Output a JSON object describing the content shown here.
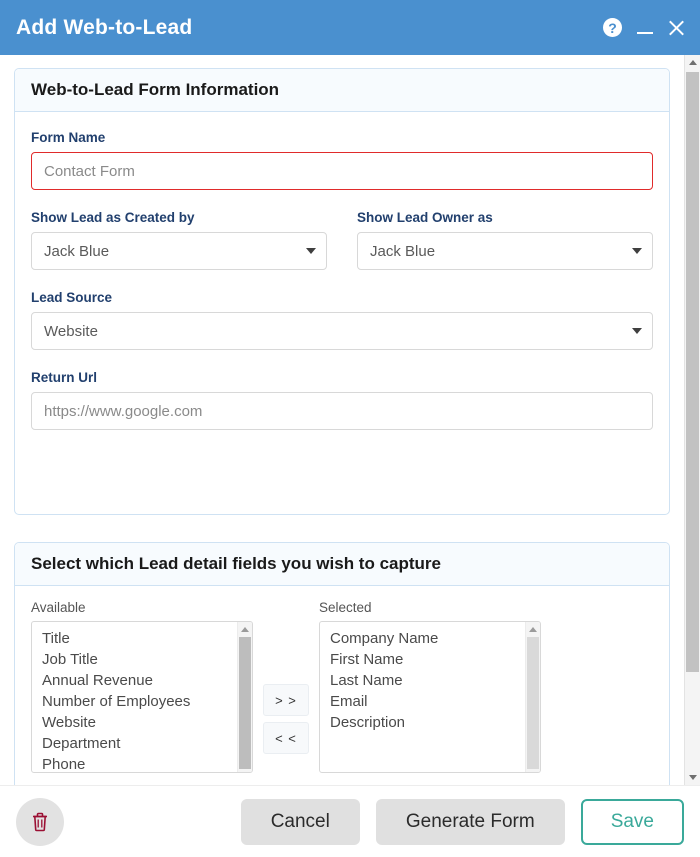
{
  "window": {
    "title": "Add Web-to-Lead",
    "header_color": "#4a90cf",
    "help_glyph": "?",
    "minimize_label": "Minimize",
    "close_label": "Close"
  },
  "info_section": {
    "heading": "Web-to-Lead Form Information",
    "form_name": {
      "label": "Form Name",
      "value": "",
      "placeholder": "Contact Form",
      "invalid": true,
      "error_color": "#e02b2b"
    },
    "created_by": {
      "label": "Show Lead as Created by",
      "value": "Jack Blue"
    },
    "lead_owner": {
      "label": "Show Lead Owner as",
      "value": "Jack Blue"
    },
    "lead_source": {
      "label": "Lead Source",
      "value": "Website"
    },
    "return_url": {
      "label": "Return Url",
      "value": "",
      "placeholder": "https://www.google.com"
    }
  },
  "fields_section": {
    "heading": "Select which Lead detail fields you wish to capture",
    "available": {
      "label": "Available",
      "items": [
        "Title",
        "Job Title",
        "Annual Revenue",
        "Number of Employees",
        "Website",
        "Department",
        "Phone"
      ]
    },
    "selected": {
      "label": "Selected",
      "items": [
        "Company Name",
        "First Name",
        "Last Name",
        "Email",
        "Description"
      ]
    },
    "add_button": "> >",
    "remove_button": "< <"
  },
  "footer": {
    "delete_label": "Delete",
    "cancel_label": "Cancel",
    "generate_label": "Generate Form",
    "save_label": "Save",
    "save_color": "#3aa99a",
    "delete_icon_color": "#9b0f33"
  }
}
